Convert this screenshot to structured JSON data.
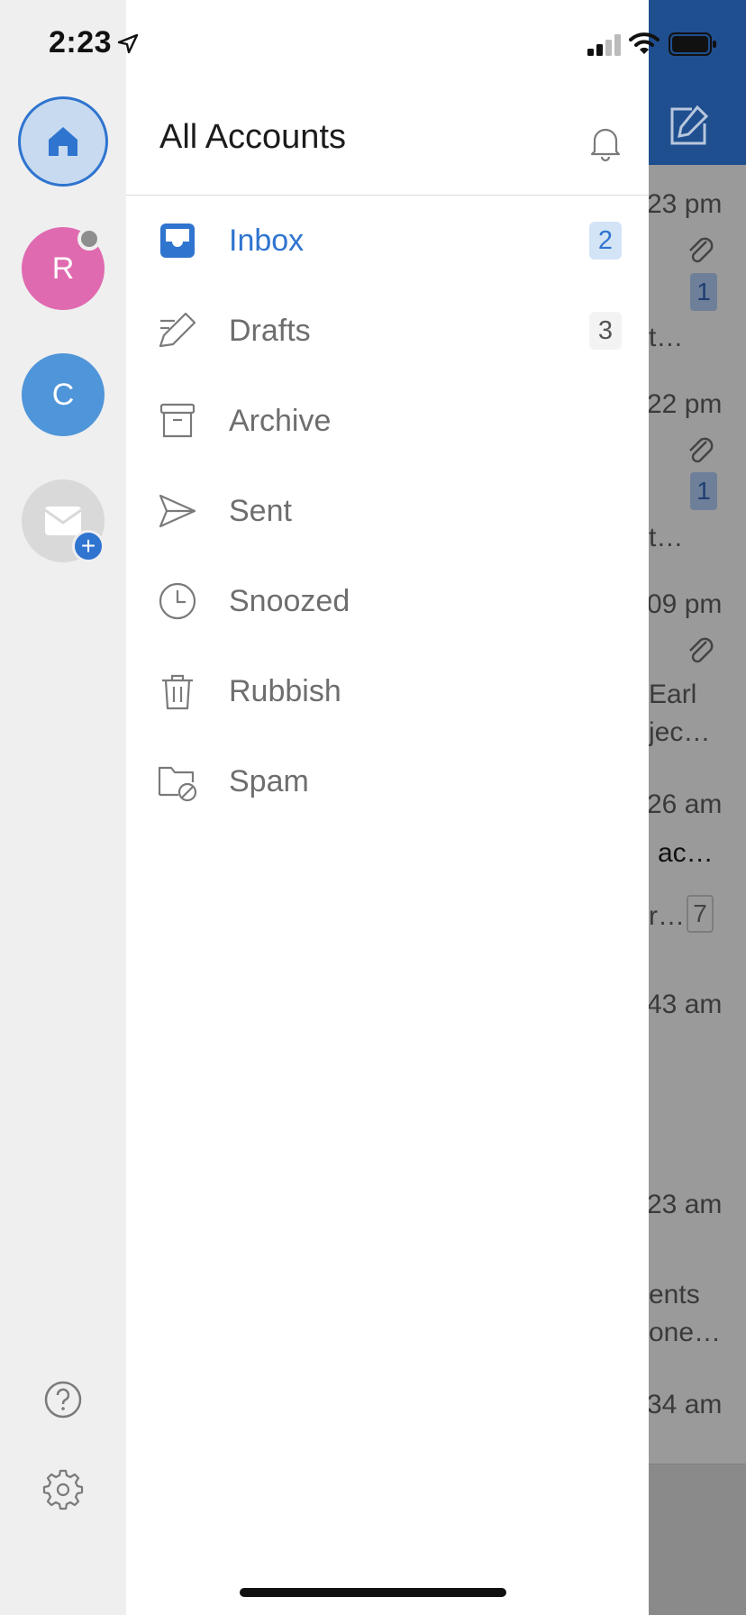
{
  "status_bar": {
    "time": "2:23"
  },
  "rail": {
    "accounts": [
      {
        "initial": "R",
        "color": "#e06ab0"
      },
      {
        "initial": "C",
        "color": "#4f95d9"
      }
    ],
    "add_badge": "+"
  },
  "panel": {
    "title": "All Accounts",
    "folders": [
      {
        "label": "Inbox",
        "count": "2",
        "icon": "inbox-icon"
      },
      {
        "label": "Drafts",
        "count": "3",
        "icon": "drafts-icon"
      },
      {
        "label": "Archive",
        "icon": "archive-icon"
      },
      {
        "label": "Sent",
        "icon": "sent-icon"
      },
      {
        "label": "Snoozed",
        "icon": "clock-icon"
      },
      {
        "label": "Rubbish",
        "icon": "trash-icon"
      },
      {
        "label": "Spam",
        "icon": "spam-folder-icon"
      }
    ]
  },
  "background_list": {
    "times": [
      "23 pm",
      "22 pm",
      "09 pm",
      "26 am",
      "43 am",
      "23 am",
      "34 am"
    ],
    "snippets": [
      "t…",
      "t…",
      "Earl",
      "jec…",
      "ac…",
      "r…",
      "ents",
      "one…"
    ],
    "counts": [
      "1",
      "1",
      "7"
    ]
  },
  "colors": {
    "accent": "#2f74cf",
    "header": "#1f4f8f"
  }
}
